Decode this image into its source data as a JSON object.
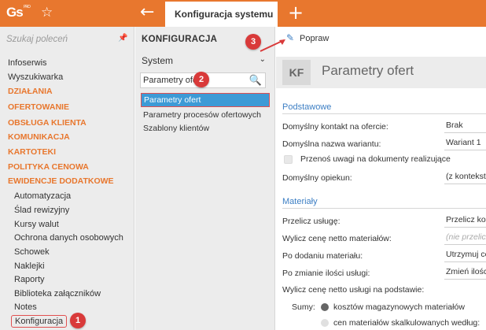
{
  "topbar": {
    "logo": "Gs",
    "logo_sup": "PRO",
    "tab_title": "Konfiguracja systemu"
  },
  "sidebar": {
    "search_placeholder": "Szukaj poleceń",
    "items": [
      {
        "label": "Infoserwis",
        "kind": "plain"
      },
      {
        "label": "Wyszukiwarka",
        "kind": "plain"
      },
      {
        "label": "DZIAŁANIA",
        "kind": "section"
      },
      {
        "label": "OFERTOWANIE",
        "kind": "section"
      },
      {
        "label": "OBSŁUGA KLIENTA",
        "kind": "section"
      },
      {
        "label": "KOMUNIKACJA",
        "kind": "section"
      },
      {
        "label": "KARTOTEKI",
        "kind": "section"
      },
      {
        "label": "POLITYKA CENOWA",
        "kind": "section"
      },
      {
        "label": "EWIDENCJE DODATKOWE",
        "kind": "section"
      },
      {
        "label": "Automatyzacja",
        "kind": "sub"
      },
      {
        "label": "Ślad rewizyjny",
        "kind": "sub"
      },
      {
        "label": "Kursy walut",
        "kind": "sub"
      },
      {
        "label": "Ochrona danych osobowych",
        "kind": "sub"
      },
      {
        "label": "Schowek",
        "kind": "sub"
      },
      {
        "label": "Naklejki",
        "kind": "sub"
      },
      {
        "label": "Raporty",
        "kind": "sub"
      },
      {
        "label": "Biblioteka załączników",
        "kind": "sub"
      },
      {
        "label": "Notes",
        "kind": "sub"
      },
      {
        "label": "Konfiguracja",
        "kind": "selected"
      }
    ]
  },
  "config": {
    "title": "KONFIGURACJA",
    "system_select": "System",
    "search_value": "Parametry ofert",
    "items": [
      "Parametry ofert",
      "Parametry procesów ofertowych",
      "Szablony klientów"
    ]
  },
  "badges": {
    "one": "1",
    "two": "2",
    "three": "3"
  },
  "content": {
    "toolbar_action": "Popraw",
    "kf_badge": "KF",
    "page_title": "Parametry ofert",
    "podstawowe": {
      "title": "Podstawowe",
      "rows": [
        {
          "label": "Domyślny kontakt na ofercie:",
          "value": "Brak"
        },
        {
          "label": "Domyślna nazwa wariantu:",
          "value": "Wariant 1"
        },
        {
          "label": "Przenoś uwagi na dokumenty realizujące",
          "value": ""
        },
        {
          "label": "Domyślny opiekun:",
          "value": "(z kontekstu)"
        }
      ]
    },
    "materialy": {
      "title": "Materiały",
      "rows": [
        {
          "label": "Przelicz usługę:",
          "value": "Przelicz kosz"
        },
        {
          "label": "Wylicz cenę netto materiałów:",
          "value": "(nie przeliczaj)"
        },
        {
          "label": "Po dodaniu materiału:",
          "value": "Utrzymuj cenę"
        },
        {
          "label": "Po zmianie ilości usługi:",
          "value": "Zmień ilości"
        },
        {
          "label": "Wylicz cenę netto usługi na podstawie:",
          "value": ""
        }
      ],
      "sumy_label": "Sumy:",
      "radio_options": [
        "kosztów magazynowych materiałów",
        "cen materiałów skalkulowanych według:"
      ]
    }
  }
}
